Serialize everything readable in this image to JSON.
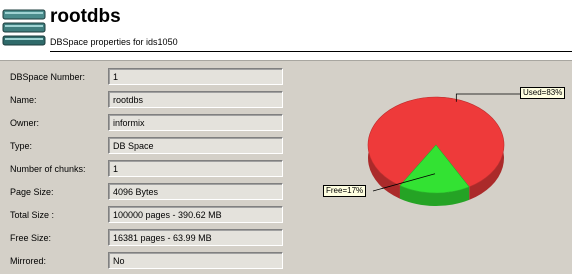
{
  "header": {
    "title": "rootdbs",
    "subtitle": "DBSpace properties for ids1050",
    "icon": "database-icon"
  },
  "properties": [
    {
      "label": "DBSpace Number:",
      "value": "1"
    },
    {
      "label": "Name:",
      "value": "rootdbs"
    },
    {
      "label": "Owner:",
      "value": "informix"
    },
    {
      "label": "Type:",
      "value": "DB Space"
    },
    {
      "label": "Number of chunks:",
      "value": "1"
    },
    {
      "label": "Page Size:",
      "value": "4096 Bytes"
    },
    {
      "label": "Total Size :",
      "value": "100000 pages - 390.62 MB"
    },
    {
      "label": "Free Size:",
      "value": "16381 pages - 63.99 MB"
    },
    {
      "label": "Mirrored:",
      "value": "No"
    }
  ],
  "chart_data": {
    "type": "pie",
    "labels": [
      "Used",
      "Free"
    ],
    "values": [
      83,
      17
    ],
    "colors": [
      "#ee3a3a",
      "#33e233"
    ],
    "data_labels": [
      "Used=83%",
      "Free=17%"
    ]
  }
}
